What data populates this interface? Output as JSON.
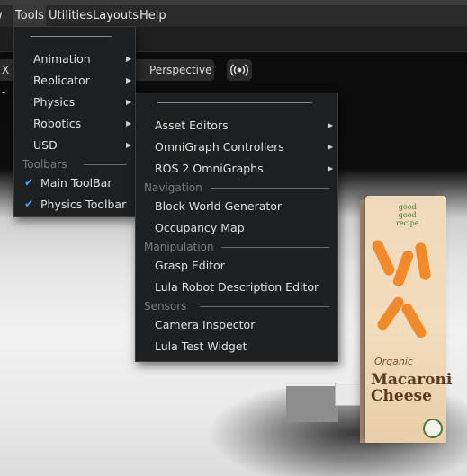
{
  "menubar": {
    "items": [
      {
        "label": "w"
      },
      {
        "label": "Tools"
      },
      {
        "label": "Utilities"
      },
      {
        "label": "Layouts"
      },
      {
        "label": "Help"
      }
    ]
  },
  "viewport": {
    "camera_label": "X -",
    "perspective_label": "Perspective",
    "live_icon": "broadcast-icon",
    "product": {
      "brand": "good\ngood\nrecipe",
      "line1": "Organic",
      "line2": "Macaroni Cheese"
    }
  },
  "tools_menu": {
    "items": [
      {
        "label": "Animation",
        "submenu": true
      },
      {
        "label": "Replicator",
        "submenu": true
      },
      {
        "label": "Physics",
        "submenu": true
      },
      {
        "label": "Robotics",
        "submenu": true
      },
      {
        "label": "USD",
        "submenu": true
      }
    ],
    "section_toolbars": "Toolbars",
    "checks": [
      {
        "label": "Main ToolBar",
        "checked": true
      },
      {
        "label": "Physics Toolbar",
        "checked": true
      }
    ]
  },
  "physics_menu": {
    "top_items": [
      {
        "label": "Asset Editors",
        "submenu": true
      },
      {
        "label": "OmniGraph Controllers",
        "submenu": true
      },
      {
        "label": "ROS 2 OmniGraphs",
        "submenu": true
      }
    ],
    "section_navigation": "Navigation",
    "navigation_items": [
      {
        "label": "Block World Generator"
      },
      {
        "label": "Occupancy Map"
      }
    ],
    "section_manipulation": "Manipulation",
    "manipulation_items": [
      {
        "label": "Grasp Editor"
      },
      {
        "label": "Lula Robot Description Editor"
      }
    ],
    "section_sensors": "Sensors",
    "sensor_items": [
      {
        "label": "Camera Inspector"
      },
      {
        "label": "Lula Test Widget"
      }
    ]
  },
  "colors": {
    "menu_bg": "#1e1f20",
    "check_accent": "#3fa0ff",
    "section_text": "#7c7c7c"
  }
}
